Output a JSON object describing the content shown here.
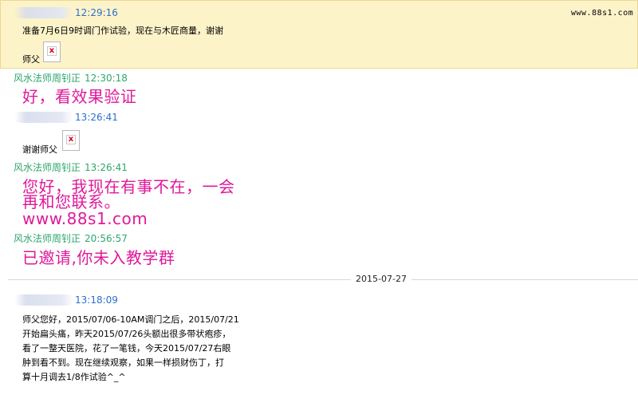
{
  "watermark": "www.88s1.com",
  "date_divider": "2015-07-27",
  "messages": [
    {
      "time": "12:29:16",
      "lines": [
        "准备7月6日9时调门作试验，现在与木匠商量，谢谢",
        "师父"
      ]
    },
    {
      "sender": "风水法师周钊正",
      "time": "12:30:18",
      "lines": [
        "好，看效果验证"
      ]
    },
    {
      "time": "13:26:41",
      "lines": [
        "谢谢师父"
      ]
    },
    {
      "sender": "风水法师周钊正",
      "time": "13:26:41",
      "lines": [
        "您好，我现在有事不在，一会",
        "再和您联系。",
        "www.88s1.com"
      ]
    },
    {
      "sender": "风水法师周钊正",
      "time": "20:56:57",
      "lines": [
        "已邀请,你未入教学群"
      ]
    },
    {
      "time": "13:18:09",
      "lines": [
        "师父您好，2015/07/06-10AM调门之后，2015/07/21",
        "开始扁头痛，昨天2015/07/26头额出很多带状疱疹，",
        "看了一整天医院，花了一笔钱，今天2015/07/27右眼",
        "肿到看不到。现在继续观察，如果一样损财伤丁，打",
        "算十月调去1/8作试验^_^"
      ]
    }
  ],
  "colors": {
    "time": "#2b6fd0",
    "sender": "#2ea66b",
    "big_text": "#e0199a",
    "highlight_bg": "#fdf3c9"
  },
  "icons": [
    "broken-image-icon"
  ]
}
